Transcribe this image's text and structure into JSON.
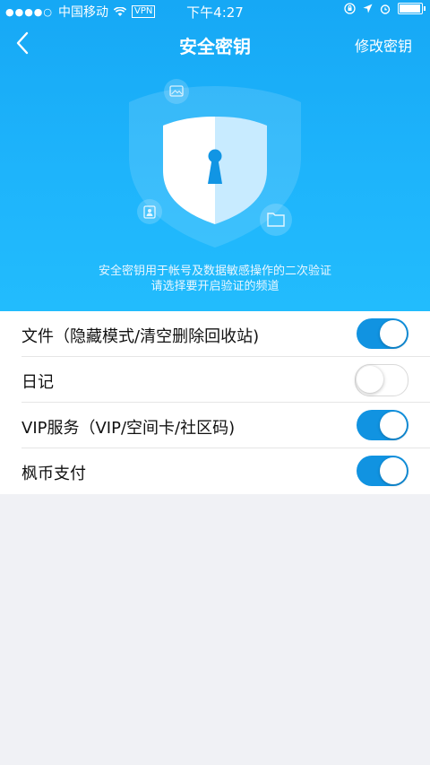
{
  "status_bar": {
    "carrier": "中国移动",
    "vpn": "VPN",
    "time": "下午4:27"
  },
  "nav": {
    "title": "安全密钥",
    "action": "修改密钥"
  },
  "description": {
    "line1": "安全密钥用于帐号及数据敏感操作的二次验证",
    "line2": "请选择要开启验证的频道"
  },
  "settings": [
    {
      "label": "文件（隐藏模式/清空删除回收站)",
      "enabled": true
    },
    {
      "label": "日记",
      "enabled": false
    },
    {
      "label": "VIP服务（VIP/空间卡/社区码)",
      "enabled": true
    },
    {
      "label": "枫币支付",
      "enabled": true
    }
  ],
  "colors": {
    "accent": "#1193e1",
    "hero": "#1eb4fb"
  }
}
